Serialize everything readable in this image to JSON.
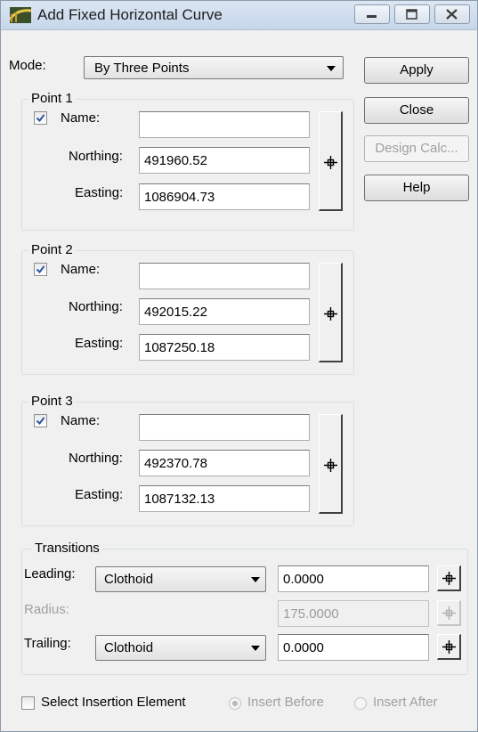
{
  "window": {
    "title": "Add Fixed Horizontal Curve"
  },
  "mode": {
    "label": "Mode:",
    "value": "By Three Points"
  },
  "buttons": {
    "apply": "Apply",
    "close": "Close",
    "design_calc": "Design Calc...",
    "help": "Help"
  },
  "fields": {
    "name": "Name:",
    "northing": "Northing:",
    "easting": "Easting:"
  },
  "points": [
    {
      "title": "Point 1",
      "checked": true,
      "name_value": "",
      "northing": "491960.52",
      "easting": "1086904.73"
    },
    {
      "title": "Point 2",
      "checked": true,
      "name_value": "",
      "northing": "492015.22",
      "easting": "1087250.18"
    },
    {
      "title": "Point 3",
      "checked": true,
      "name_value": "",
      "northing": "492370.78",
      "easting": "1087132.13"
    }
  ],
  "transitions": {
    "title": "Transitions",
    "leading_label": "Leading:",
    "leading_type": "Clothoid",
    "leading_value": "0.0000",
    "radius_label": "Radius:",
    "radius_value": "175.0000",
    "trailing_label": "Trailing:",
    "trailing_type": "Clothoid",
    "trailing_value": "0.0000"
  },
  "insertion": {
    "select_label": "Select Insertion Element",
    "insert_before": "Insert Before",
    "insert_after": "Insert After"
  },
  "icons": {
    "app": "horizontal-curve-icon",
    "minimize": "minimize-icon",
    "maximize": "maximize-icon",
    "close": "close-icon",
    "locate": "crosshair-locate-icon",
    "dropdown": "chevron-down-icon",
    "check": "checkmark-icon"
  },
  "colors": {
    "title_bar": "#c9d9ec",
    "check": "#2a53a6",
    "disabled_text": "#a0a0a0"
  }
}
